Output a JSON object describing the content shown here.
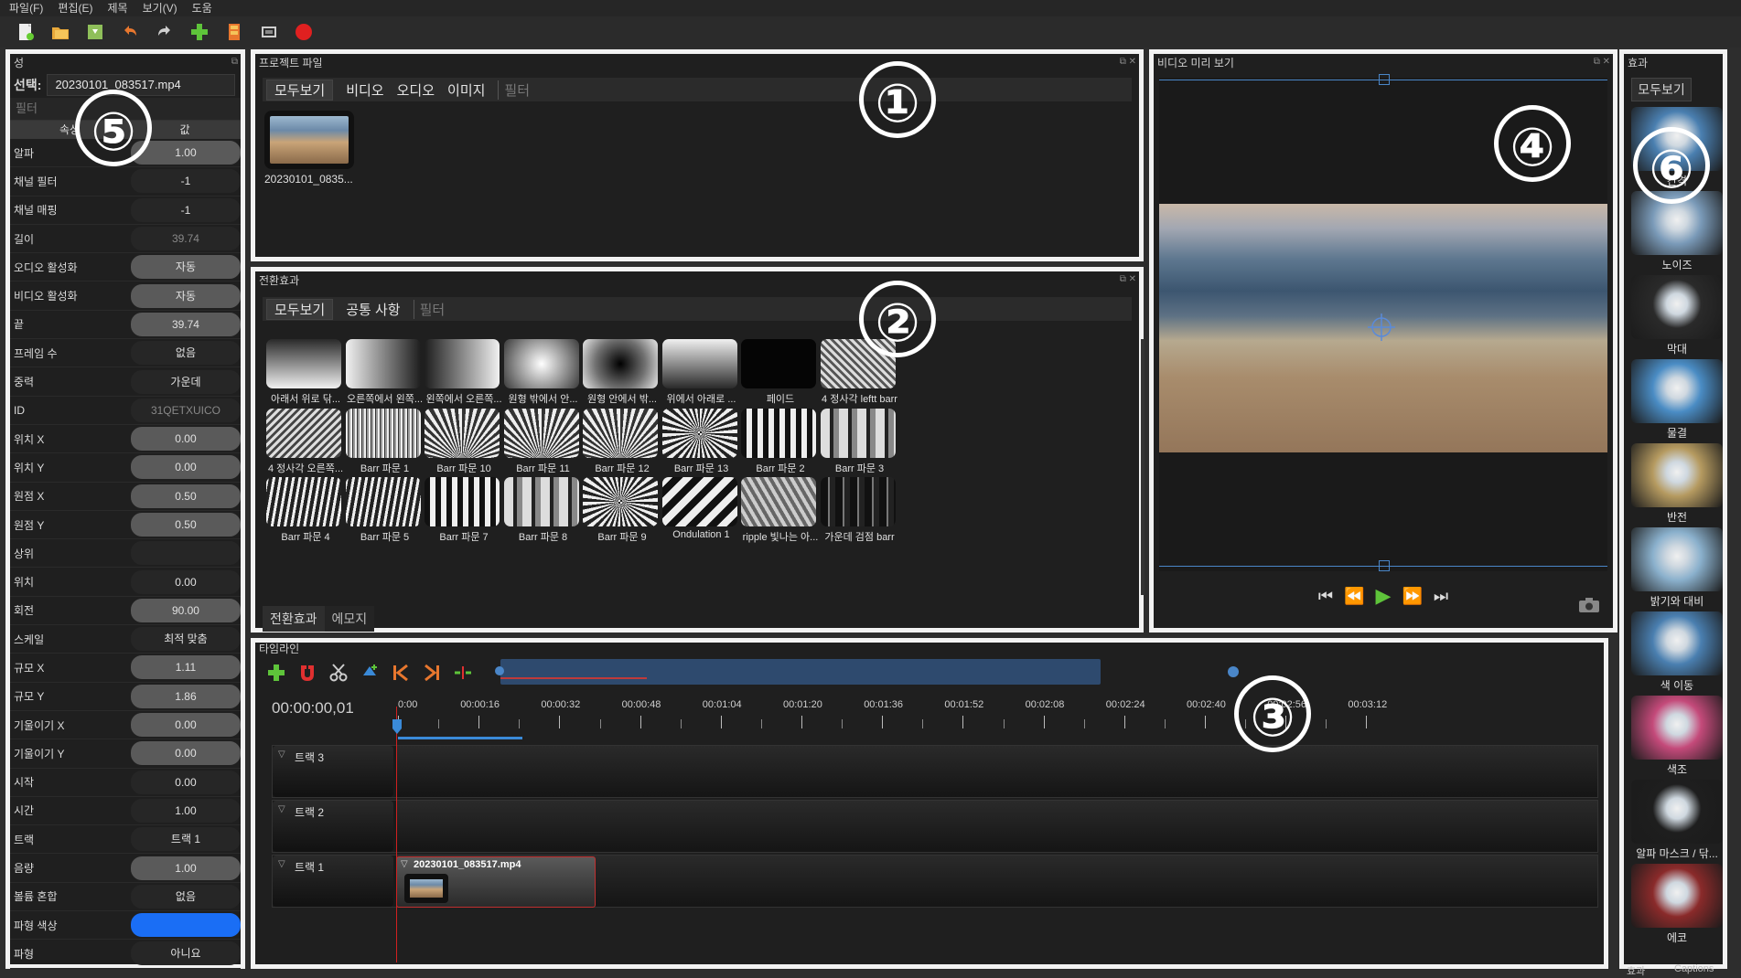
{
  "menu": [
    "파일(F)",
    "편집(E)",
    "제목",
    "보기(V)",
    "도움"
  ],
  "props": {
    "title": "성",
    "select_label": "선택:",
    "select_value": "20230101_083517.mp4",
    "filter_placeholder": "필터",
    "col_prop": "속성",
    "col_value": "값",
    "rows": [
      {
        "name": "알파",
        "value": "1.00",
        "kind": "slider"
      },
      {
        "name": "채널 필터",
        "value": "-1",
        "kind": "plain"
      },
      {
        "name": "채널 매핑",
        "value": "-1",
        "kind": "plain"
      },
      {
        "name": "길이",
        "value": "39.74",
        "kind": "dim"
      },
      {
        "name": "오디오 활성화",
        "value": "자동",
        "kind": "slider"
      },
      {
        "name": "비디오 활성화",
        "value": "자동",
        "kind": "slider"
      },
      {
        "name": "끝",
        "value": "39.74",
        "kind": "slider"
      },
      {
        "name": "프레임 수",
        "value": "없음",
        "kind": "plain"
      },
      {
        "name": "중력",
        "value": "가운데",
        "kind": "plain"
      },
      {
        "name": "ID",
        "value": "31QETXUICO",
        "kind": "dim"
      },
      {
        "name": "위치 X",
        "value": "0.00",
        "kind": "slider"
      },
      {
        "name": "위치 Y",
        "value": "0.00",
        "kind": "slider"
      },
      {
        "name": "원점 X",
        "value": "0.50",
        "kind": "slider"
      },
      {
        "name": "원점 Y",
        "value": "0.50",
        "kind": "slider"
      },
      {
        "name": "상위",
        "value": "",
        "kind": "plain"
      },
      {
        "name": "위치",
        "value": "0.00",
        "kind": "plain"
      },
      {
        "name": "회전",
        "value": "90.00",
        "kind": "slider"
      },
      {
        "name": "스케일",
        "value": "최적 맞춤",
        "kind": "plain"
      },
      {
        "name": "규모 X",
        "value": "1.11",
        "kind": "slider"
      },
      {
        "name": "규모 Y",
        "value": "1.86",
        "kind": "slider"
      },
      {
        "name": "기울이기 X",
        "value": "0.00",
        "kind": "slider"
      },
      {
        "name": "기울이기 Y",
        "value": "0.00",
        "kind": "slider"
      },
      {
        "name": "시작",
        "value": "0.00",
        "kind": "plain"
      },
      {
        "name": "시간",
        "value": "1.00",
        "kind": "plain"
      },
      {
        "name": "트랙",
        "value": "트랙 1",
        "kind": "plain"
      },
      {
        "name": "음량",
        "value": "1.00",
        "kind": "slider"
      },
      {
        "name": "볼륨 혼합",
        "value": "없음",
        "kind": "plain"
      },
      {
        "name": "파형 색상",
        "value": "",
        "kind": "color"
      },
      {
        "name": "파형",
        "value": "아니요",
        "kind": "plain"
      }
    ]
  },
  "project_files": {
    "title": "프로젝트 파일",
    "tabs": [
      "모두보기",
      "비디오",
      "오디오",
      "이미지"
    ],
    "filter_placeholder": "필터",
    "files": [
      {
        "name": "20230101_0835..."
      }
    ]
  },
  "transitions": {
    "title": "전환효과",
    "tabs": [
      "모두보기",
      "공통 사항"
    ],
    "filter_placeholder": "필터",
    "items": [
      {
        "name": "아래서 위로 닦...",
        "style": "grad-v"
      },
      {
        "name": "오른쪽에서 왼쪽...",
        "style": "grad-h"
      },
      {
        "name": "왼쪽에서 오른쪽...",
        "style": "grad-hr"
      },
      {
        "name": "원형 밖에서 안...",
        "style": "radial-out"
      },
      {
        "name": "원형 안에서 밖...",
        "style": "radial-in"
      },
      {
        "name": "위에서 아래로 ...",
        "style": "grad-vr"
      },
      {
        "name": "페이드",
        "style": "black"
      },
      {
        "name": "4 정사각 leftt barr",
        "style": "diag"
      },
      {
        "name": "4 정사각 오른쪽...",
        "style": "diag2"
      },
      {
        "name": "Barr 파문 1",
        "style": "noise"
      },
      {
        "name": "Barr 파문 10",
        "style": "fan"
      },
      {
        "name": "Barr 파문 11",
        "style": "fan"
      },
      {
        "name": "Barr 파문 12",
        "style": "fan"
      },
      {
        "name": "Barr 파문 13",
        "style": "burst"
      },
      {
        "name": "Barr 파문 2",
        "style": "vstripes"
      },
      {
        "name": "Barr 파문 3",
        "style": "vstripes2"
      },
      {
        "name": "Barr 파문 4",
        "style": "waves"
      },
      {
        "name": "Barr 파문 5",
        "style": "waves"
      },
      {
        "name": "Barr 파문 7",
        "style": "vstripes"
      },
      {
        "name": "Barr 파문 8",
        "style": "vstripes2"
      },
      {
        "name": "Barr 파문 9",
        "style": "burst"
      },
      {
        "name": "Ondulation 1",
        "style": "zigzag"
      },
      {
        "name": "ripple 빛나는 아...",
        "style": "chevron"
      },
      {
        "name": "가운데 검점 barr",
        "style": "dark-stripes"
      }
    ],
    "bottom_tabs": [
      "전환효과",
      "에모지"
    ]
  },
  "preview": {
    "title": "비디오 미리 보기"
  },
  "effects": {
    "title": "효과",
    "tab": "모두보기",
    "items": [
      {
        "name": "간격",
        "color": "#4a7fb0"
      },
      {
        "name": "노이즈",
        "color": "#7a9ab8"
      },
      {
        "name": "막대",
        "color": "#2a2a2a"
      },
      {
        "name": "물결",
        "color": "#4a8cc4"
      },
      {
        "name": "반전",
        "color": "#b59a60"
      },
      {
        "name": "밝기와 대비",
        "color": "#8ab0cc"
      },
      {
        "name": "색 이동",
        "color": "#4a7fb0"
      },
      {
        "name": "색조",
        "color": "#c44a7a"
      },
      {
        "name": "알파 마스크 / 닦...",
        "color": "#1e1e1e"
      },
      {
        "name": "에코",
        "color": "#8a2a2a"
      }
    ]
  },
  "timeline": {
    "title": "타임라인",
    "timecode": "00:00:00,01",
    "ruler": [
      "0:00",
      "00:00:16",
      "00:00:32",
      "00:00:48",
      "00:01:04",
      "00:01:20",
      "00:01:36",
      "00:01:52",
      "00:02:08",
      "00:02:24",
      "00:02:40",
      "00:02:56",
      "00:03:12"
    ],
    "tracks": [
      "트랙 3",
      "트랙 2",
      "트랙 1"
    ],
    "clip": "20230101_083517.mp4"
  },
  "markers": [
    "①",
    "②",
    "③",
    "④",
    "⑤",
    "⑥"
  ],
  "bottom_status": [
    "효과",
    "Captions"
  ]
}
